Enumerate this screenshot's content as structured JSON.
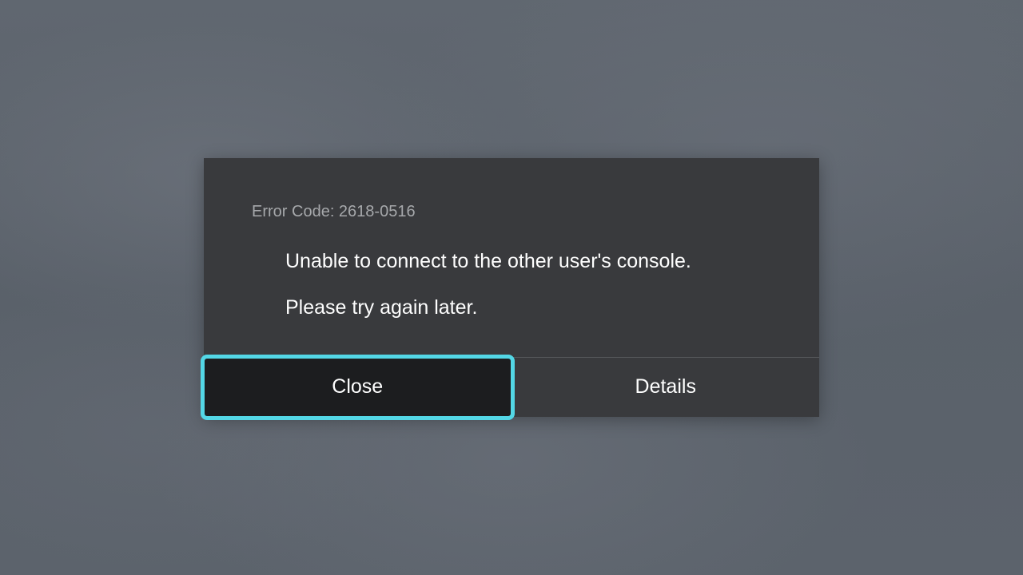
{
  "dialog": {
    "error_code": "Error Code: 2618-0516",
    "message_line1": "Unable to connect to the other user's console.",
    "message_line2": "Please try again later.",
    "buttons": {
      "close": "Close",
      "details": "Details"
    }
  },
  "colors": {
    "accent": "#53d7e6",
    "dialog_bg": "#393a3d",
    "selected_bg": "#1c1d1f"
  }
}
